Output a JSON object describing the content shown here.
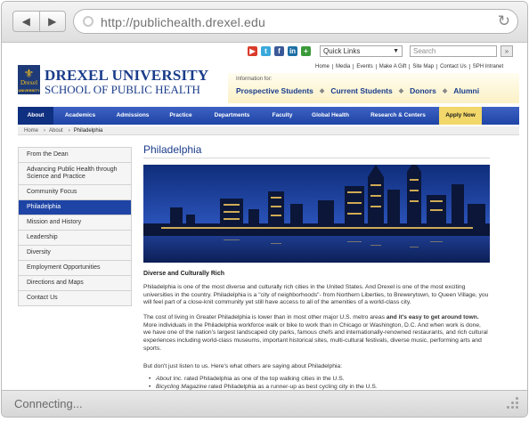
{
  "browser": {
    "url": "http://publichealth.drexel.edu",
    "back_icon": "◀",
    "forward_icon": "▶",
    "reload_icon": "↻",
    "status": "Connecting..."
  },
  "utility": {
    "quick_links": "Quick Links",
    "search_placeholder": "Search",
    "search_go": "»",
    "social": [
      {
        "icon": "youtube-icon",
        "glyph": "▶",
        "color": "#d93b2b"
      },
      {
        "icon": "twitter-icon",
        "glyph": "t",
        "color": "#3aa8db"
      },
      {
        "icon": "facebook-icon",
        "glyph": "f",
        "color": "#3b5998"
      },
      {
        "icon": "linkedin-icon",
        "glyph": "in",
        "color": "#1d6fa5"
      },
      {
        "icon": "share-icon",
        "glyph": "+",
        "color": "#3a9a3a"
      }
    ]
  },
  "header": {
    "university": "DREXEL UNIVERSITY",
    "school": "SCHOOL OF PUBLIC HEALTH",
    "logo_text": "Drexel",
    "logo_sub": "UNIVERSITY",
    "top_links": [
      "Home",
      "Media",
      "Events",
      "Make A Gift",
      "Site Map",
      "Contact Us",
      "SPH Intranet"
    ],
    "info_for": "Information for:",
    "audiences": [
      "Prospective Students",
      "Current Students",
      "Donors",
      "Alumni"
    ],
    "audience_separator": "◆"
  },
  "nav": {
    "items": [
      "About",
      "Academics",
      "Admissions",
      "Practice",
      "Departments",
      "Faculty",
      "Global Health",
      "Research & Centers",
      "Apply Now"
    ]
  },
  "breadcrumb": [
    "Home",
    "About",
    "Philadelphia"
  ],
  "sidebar": {
    "items": [
      "From the Dean",
      "Advancing Public Health through Science and Practice",
      "Community Focus",
      "Philadelphia",
      "Mission and History",
      "Leadership",
      "Diversity",
      "Employment Opportunities",
      "Directions and Maps",
      "Contact Us"
    ]
  },
  "content": {
    "title": "Philadelphia",
    "subheading": "Diverse and Culturally Rich",
    "p1": "Philadelphia is one of the most diverse and culturally rich cities in the United States. And Drexel is one of the most exciting universities in the country. Philadelphia is a \"city of neighborhoods\"- from Northern Liberties, to Brewerytown, to Queen Village, you will feel part of a close-knit community yet still have access to all of the amenities of a world-class city.",
    "p2_a": "The cost of living in Greater Philadelphia is lower than in most other major U.S. metro areas ",
    "p2_bold": "and it's easy to get around town.",
    "p2_b": " More individuals in the Philadelphia workforce walk or bike to work than in Chicago or Washington, D.C. And when work is done, we have one of the nation's largest landscaped city parks, famous chefs and internationally-renowned restaurants, and rich cultural experiences including world-class museums, important historical sites, multi-cultural festivals, diverse music, performing arts and sports.",
    "p3": "But don't just listen to us. Here's what others are saying about Philadelphia:",
    "b1_em": "About Inc.",
    "b1_rest": " rated Philadelphia as one of the top walking cities in the U.S.",
    "b2_em": "Bicycling Magazine",
    "b2_rest": " rated Philadelphia as a runner-up as best cycling city in the U.S."
  }
}
